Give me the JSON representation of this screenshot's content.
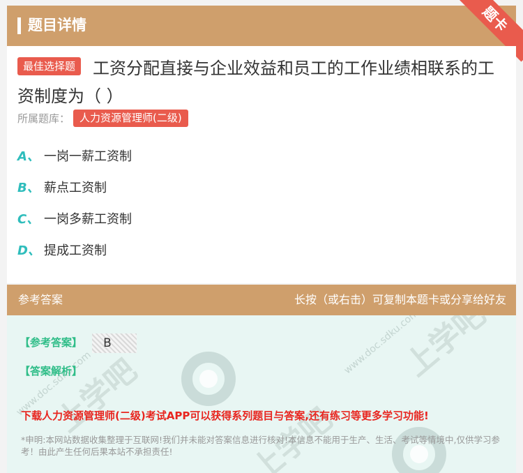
{
  "header": {
    "title": "题目详情",
    "ribbon": "题卡"
  },
  "question": {
    "badge": "最佳选择题",
    "text": "工资分配直接与企业效益和员工的工作业绩相联系的工资制度为（ ）",
    "library_label": "所属题库：",
    "library_tag": "人力资源管理师(二级)"
  },
  "options": [
    {
      "letter": "A、",
      "text": "一岗一薪工资制"
    },
    {
      "letter": "B、",
      "text": "薪点工资制"
    },
    {
      "letter": "C、",
      "text": "一岗多薪工资制"
    },
    {
      "letter": "D、",
      "text": "提成工资制"
    }
  ],
  "answer_section": {
    "title": "参考答案",
    "hint": "长按（或右击）可复制本题卡或分享给好友",
    "answer_label": "【参考答案】",
    "answer_value": "B",
    "analysis_label": "【答案解析】",
    "promo": "下载人力资源管理师(二级)考试APP可以获得系列题目与答案,还有练习等更多学习功能!",
    "disclaimer": "*申明:本网站数据收集整理于互联网!我们并未能对答案信息进行核对!本信息不能用于生产、生活、考试等情境中,仅供学习参考！由此产生任何后果本站不承担责任!",
    "watermark": "上学吧",
    "watermark_url": "www.doc.sdku.com"
  },
  "colors": {
    "brand": "#cf9f6c",
    "accent_red": "#e95b4d",
    "option_letter": "#2fbdbc",
    "answer_green": "#2fbd88",
    "promo_red": "#e8251f"
  }
}
